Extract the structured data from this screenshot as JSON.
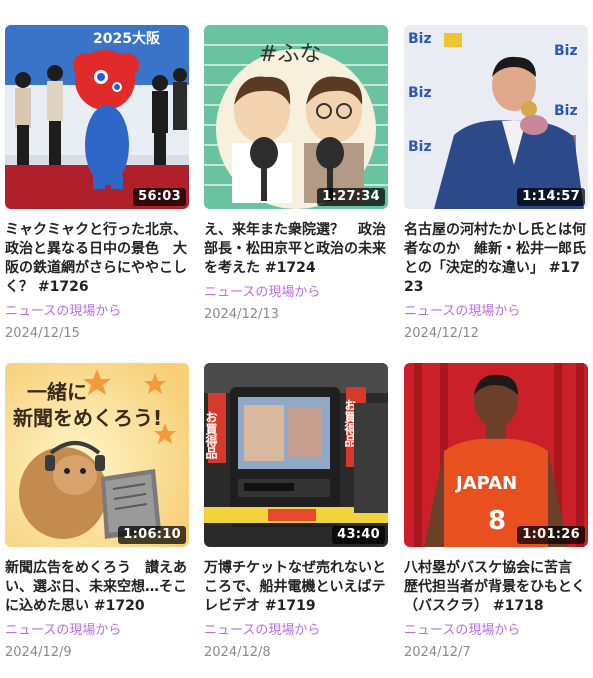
{
  "episodes": [
    {
      "duration": "56:03",
      "title": "ミャクミャクと行った北京、政治と異なる日中の景色　大阪の鉄道網がさらにややこしく？ #1726",
      "program": "ニュースの現場から",
      "date": "2024/12/15",
      "thumb_text": "2025大阪"
    },
    {
      "duration": "1:27:34",
      "title": "え、来年また衆院選？　政治部長・松田京平と政治の未来を考えた #1724",
      "program": "ニュースの現場から",
      "date": "2024/12/13",
      "thumb_text": "#ふな"
    },
    {
      "duration": "1:14:57",
      "title": "名古屋の河村たかし氏とは何者なのか　維新・松井一郎氏との「決定的な違い」 #1723",
      "program": "ニュースの現場から",
      "date": "2024/12/12",
      "thumb_text": "Biz"
    },
    {
      "duration": "1:06:10",
      "title": "新聞広告をめくろう　讃えあい、選ぶ日、未来空想…そこに込めた思い #1720",
      "program": "ニュースの現場から",
      "date": "2024/12/9",
      "thumb_text_1": "一緒に",
      "thumb_text_2": "新聞をめくろう!"
    },
    {
      "duration": "43:40",
      "title": "万博チケットなぜ売れないところで、船井電機といえばテレビデオ #1719",
      "program": "ニュースの現場から",
      "date": "2024/12/8",
      "thumb_text": "お買得品"
    },
    {
      "duration": "1:01:26",
      "title": "八村塁がバスケ協会に苦言　歴代担当者が背景をひもとく（バスクラ） #1718",
      "program": "ニュースの現場から",
      "date": "2024/12/7",
      "thumb_text": "JAPAN"
    }
  ]
}
